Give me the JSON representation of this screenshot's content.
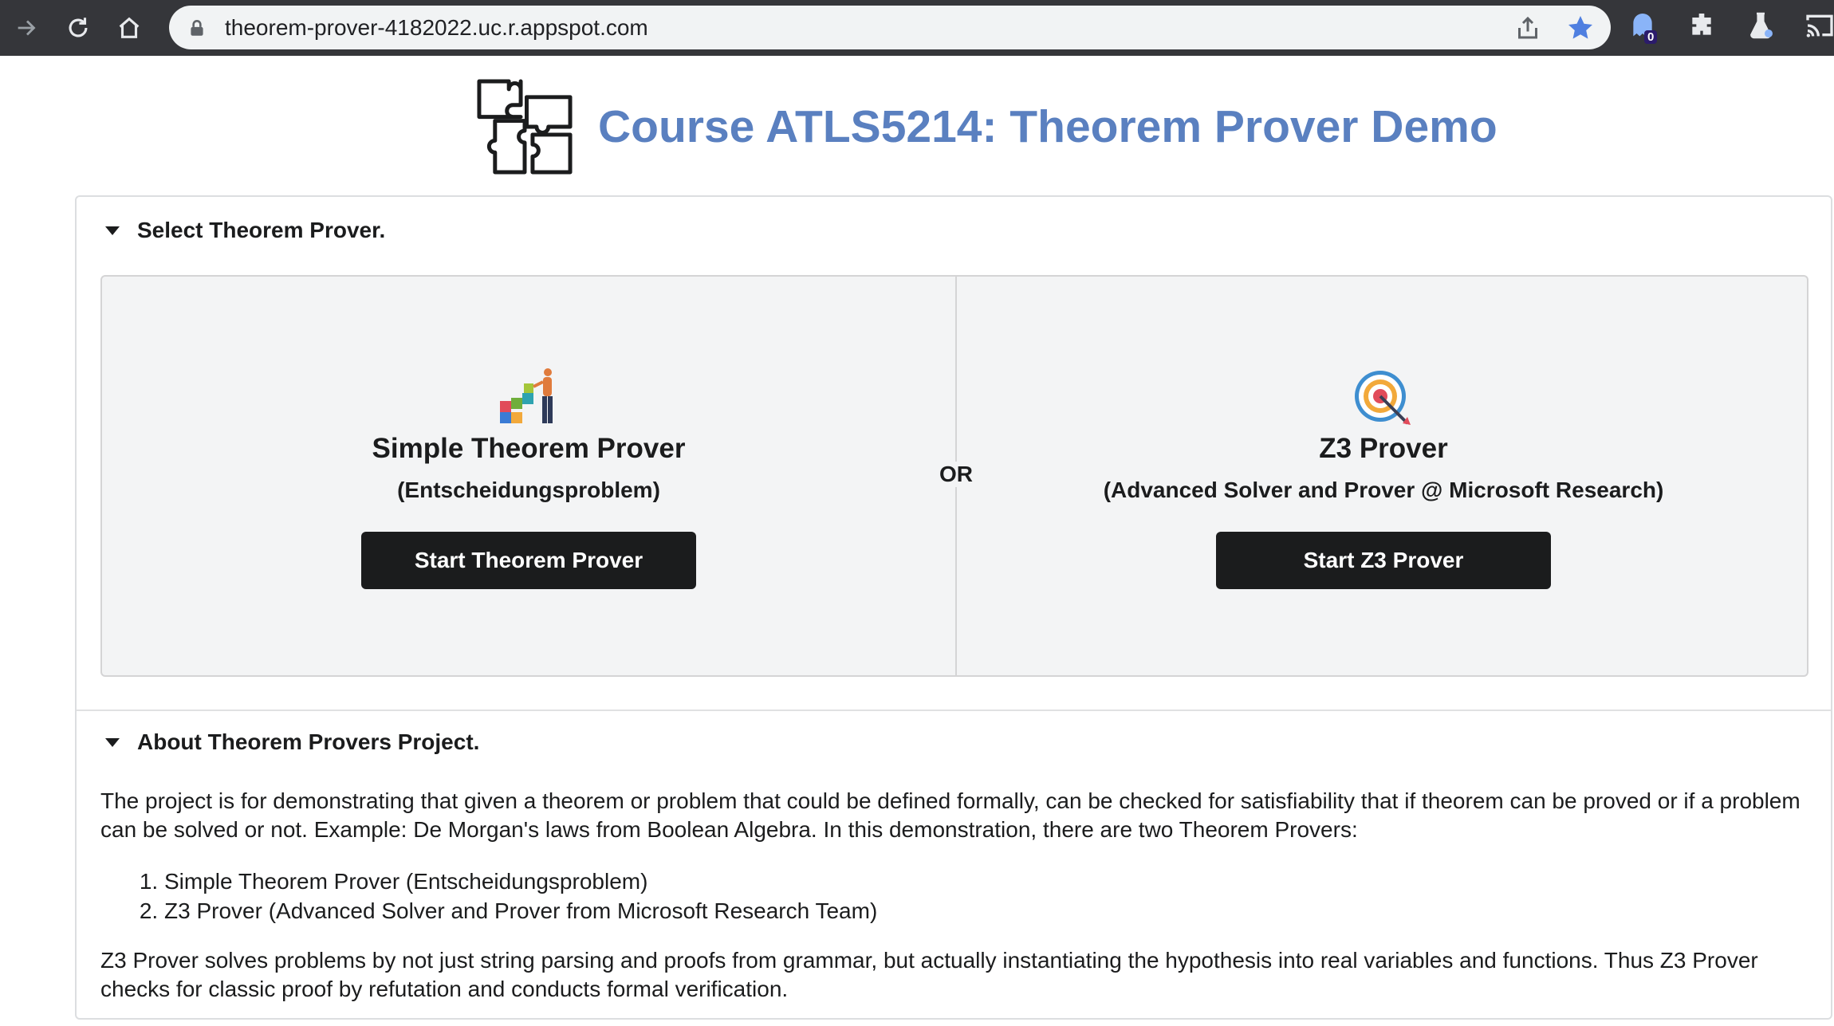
{
  "browser": {
    "url": "theorem-prover-4182022.uc.r.appspot.com",
    "extension_badge": "0"
  },
  "header": {
    "title": "Course ATLS5214: Theorem Prover Demo"
  },
  "select_section": {
    "title": "Select Theorem Prover.",
    "or_label": "OR",
    "left": {
      "title": "Simple Theorem Prover",
      "subtitle": "(Entscheidungsproblem)",
      "button": "Start Theorem Prover"
    },
    "right": {
      "title": "Z3 Prover",
      "subtitle": "(Advanced Solver and Prover @ Microsoft Research)",
      "button": "Start Z3 Prover"
    }
  },
  "about_section": {
    "title": "About Theorem Provers Project.",
    "paragraph1": "The project is for demonstrating that given a theorem or problem that could be defined formally, can be checked for satisfiability that if theorem can be proved or if a problem can be solved or not. Example: De Morgan's laws from Boolean Algebra. In this demonstration, there are two Theorem Provers:",
    "list": [
      "Simple Theorem Prover (Entscheidungsproblem)",
      "Z3 Prover (Advanced Solver and Prover from Microsoft Research Team)"
    ],
    "paragraph2": "Z3 Prover solves problems by not just string parsing and proofs from grammar, but actually instantiating the hypothesis into real variables and functions. Thus Z3 Prover checks for classic proof by refutation and conducts formal verification."
  },
  "colors": {
    "title_blue": "#5a80c0",
    "button_bg": "#1b1c1d",
    "segment_bg": "#f3f4f5",
    "chrome_bg": "#35363a"
  }
}
